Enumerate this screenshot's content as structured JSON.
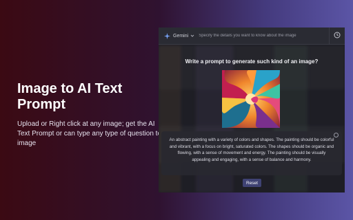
{
  "promo": {
    "title": "Image to AI Text Prompt",
    "description": "Upload or Right click at any image; get the AI Text Prompt or can type any type of question to image"
  },
  "panel": {
    "model": "Gemini",
    "prompt_placeholder": "Specify the details you want to know about the image",
    "heading": "Write a prompt to generate such kind of an image?",
    "description": "An abstract painting with a variety of colors and shapes. The painting should be colorful and vibrant, with a focus on bright, saturated colors. The shapes should be organic and flowing, with a sense of movement and energy. The painting should be visually appealing and engaging, with a sense of balance and harmony.",
    "reset_label": "Reset",
    "icons": {
      "model": "sparkle-icon",
      "model_dropdown": "chevron-down-icon",
      "history": "clock-icon",
      "dismiss": "close-icon"
    }
  },
  "colors": {
    "background_start": "#3b0a13",
    "background_end": "#5b55a6",
    "panel": "#1e1e25",
    "reset_button": "#3f4273",
    "model_icon": "#7aa7ff"
  }
}
